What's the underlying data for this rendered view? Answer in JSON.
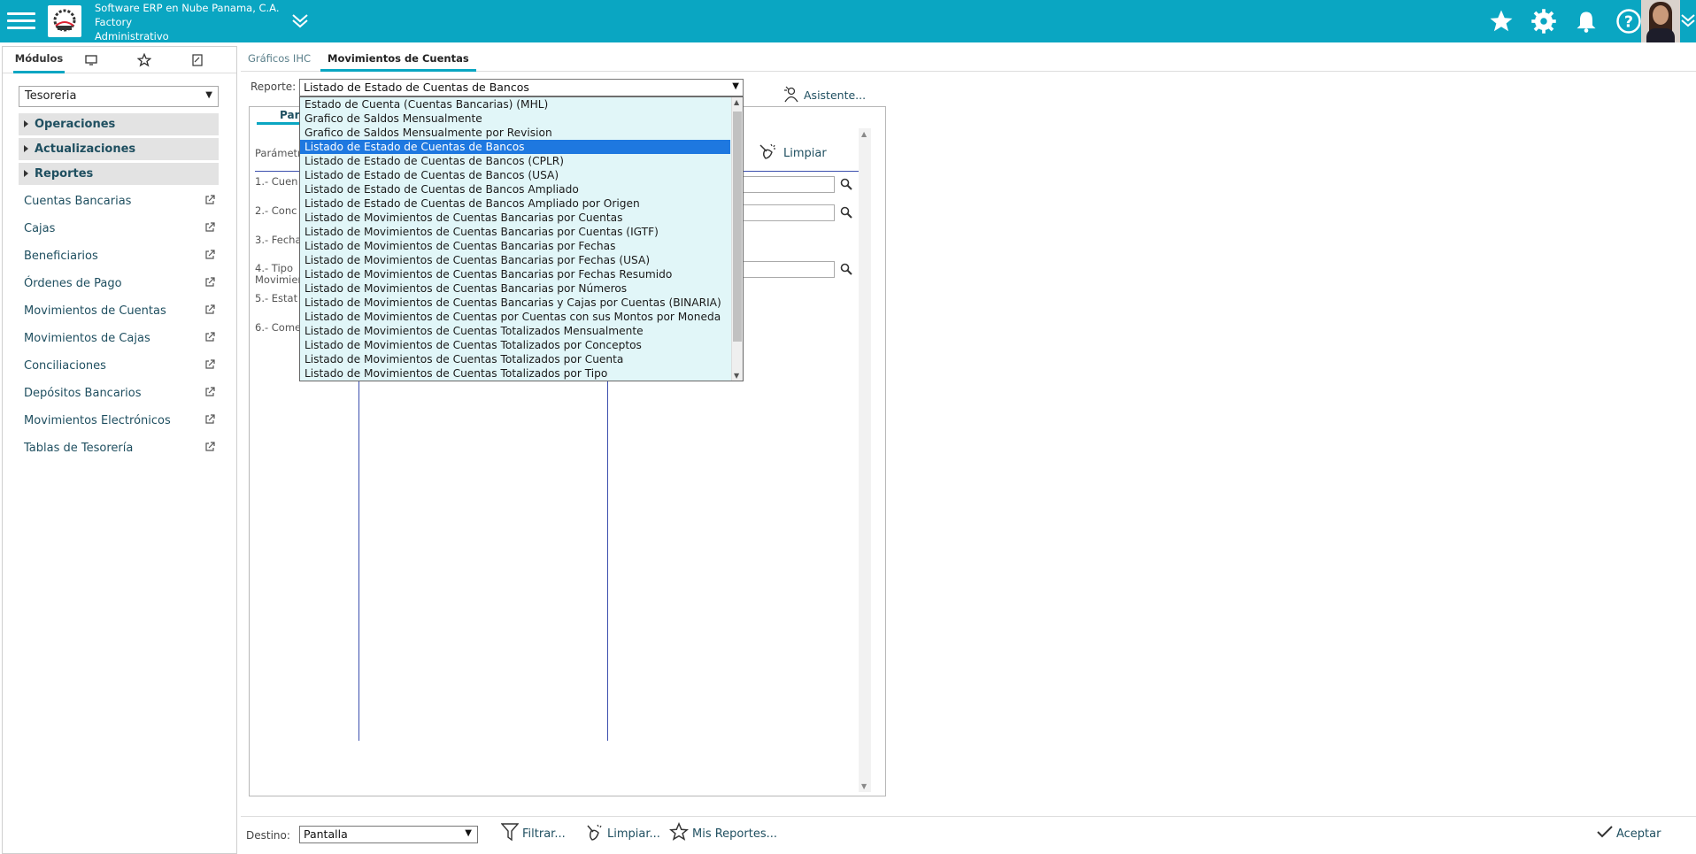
{
  "header": {
    "company_line1": "Software ERP en Nube Panama, C.A.",
    "company_line2": "Factory",
    "company_line3": "Administrativo",
    "accent_color": "#0aa6c2"
  },
  "left_panel": {
    "tabs": [
      "Módulos",
      "monitor-icon",
      "star-icon",
      "document-icon"
    ],
    "module_select": "Tesoreria",
    "groups": [
      "Operaciones",
      "Actualizaciones",
      "Reportes"
    ],
    "items": [
      "Cuentas Bancarias",
      "Cajas",
      "Beneficiarios",
      "Órdenes de Pago",
      "Movimientos de Cuentas",
      "Movimientos de Cajas",
      "Conciliaciones",
      "Depósitos Bancarios",
      "Movimientos Electrónicos",
      "Tablas de Tesorería"
    ]
  },
  "main_tabs": {
    "tab1": "Gráficos IHC",
    "tab2": "Movimientos de Cuentas"
  },
  "report": {
    "label": "Reporte:",
    "selected": "Listado de Estado de Cuentas de Bancos",
    "asistente": "Asistente...",
    "options": [
      "Estado de Cuenta (Cuentas Bancarias) (MHL)",
      "Grafico de Saldos Mensualmente",
      "Grafico de Saldos Mensualmente por Revision",
      "Listado de Estado de Cuentas de Bancos",
      "Listado de Estado de Cuentas de Bancos (CPLR)",
      "Listado de Estado de Cuentas de Bancos (USA)",
      "Listado de Estado de Cuentas de Bancos Ampliado",
      "Listado de Estado de Cuentas de Bancos Ampliado por Origen",
      "Listado de Movimientos de Cuentas Bancarias por Cuentas",
      "Listado de Movimientos de Cuentas Bancarias por Cuentas (IGTF)",
      "Listado de Movimientos de Cuentas Bancarias por Fechas",
      "Listado de Movimientos de Cuentas Bancarias por Fechas (USA)",
      "Listado de Movimientos de Cuentas Bancarias por Fechas Resumido",
      "Listado de Movimientos de Cuentas Bancarias por Números",
      "Listado de Movimientos de Cuentas Bancarias y Cajas por Cuentas (BINARIA)",
      "Listado de Movimientos de Cuentas por Cuentas con sus Montos por Moneda",
      "Listado de Movimientos de Cuentas Totalizados Mensualmente",
      "Listado de Movimientos de Cuentas Totalizados por Conceptos",
      "Listado de Movimientos de Cuentas Totalizados por Cuenta",
      "Listado de Movimientos de Cuentas Totalizados por Tipo"
    ]
  },
  "params": {
    "tab": "Pará",
    "header": "Parámetr",
    "limpiar": "Limpiar",
    "rows": [
      "1.- Cuen",
      "2.- Conc",
      "3.- Fecha",
      "4.- Tipo",
      "Movimier",
      "5.- Estat",
      "6.- Come"
    ]
  },
  "footer": {
    "destino_label": "Destino:",
    "destino_value": "Pantalla",
    "filtrar": "Filtrar...",
    "limpiar": "Limpiar...",
    "mis_reportes": "Mis Reportes...",
    "aceptar": "Aceptar"
  }
}
